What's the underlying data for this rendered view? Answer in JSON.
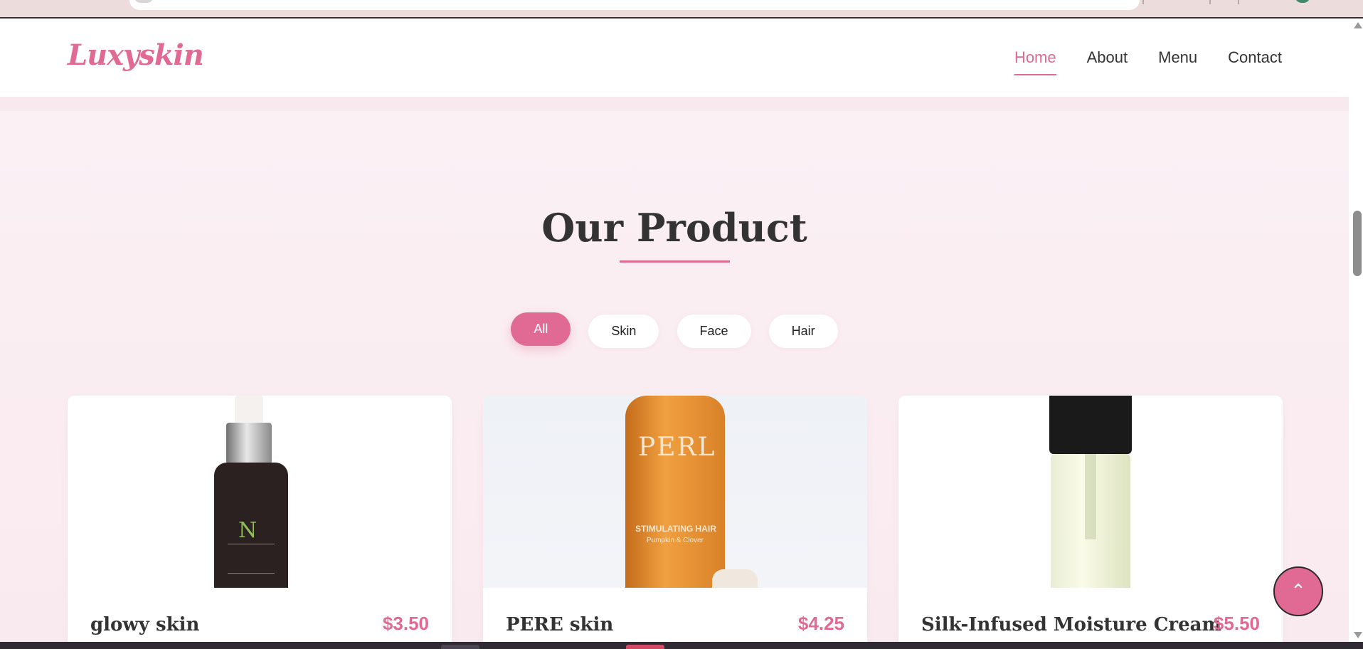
{
  "navbar": {
    "logo": "Luxyskin",
    "links": [
      {
        "label": "Home",
        "active": true
      },
      {
        "label": "About",
        "active": false
      },
      {
        "label": "Menu",
        "active": false
      },
      {
        "label": "Contact",
        "active": false
      }
    ]
  },
  "section": {
    "title": "Our Product"
  },
  "filters": [
    {
      "label": "All",
      "active": true
    },
    {
      "label": "Skin",
      "active": false
    },
    {
      "label": "Face",
      "active": false
    },
    {
      "label": "Hair",
      "active": false
    }
  ],
  "products": [
    {
      "name": "glowy skin",
      "price": "$3.50",
      "image_label": "N"
    },
    {
      "name": "PERE skin",
      "price": "$4.25",
      "image_brand": "PERL",
      "image_tag": "STIMULATING HAIR",
      "image_sub": "Pumpkin & Clover"
    },
    {
      "name": "Silk-Infused Moisture Cream",
      "price": "$5.50"
    }
  ],
  "scroll_top": {
    "icon": "chevron-up-icon"
  },
  "colors": {
    "accent": "#e06a93",
    "text": "#333333",
    "background": "#fbeff3"
  }
}
